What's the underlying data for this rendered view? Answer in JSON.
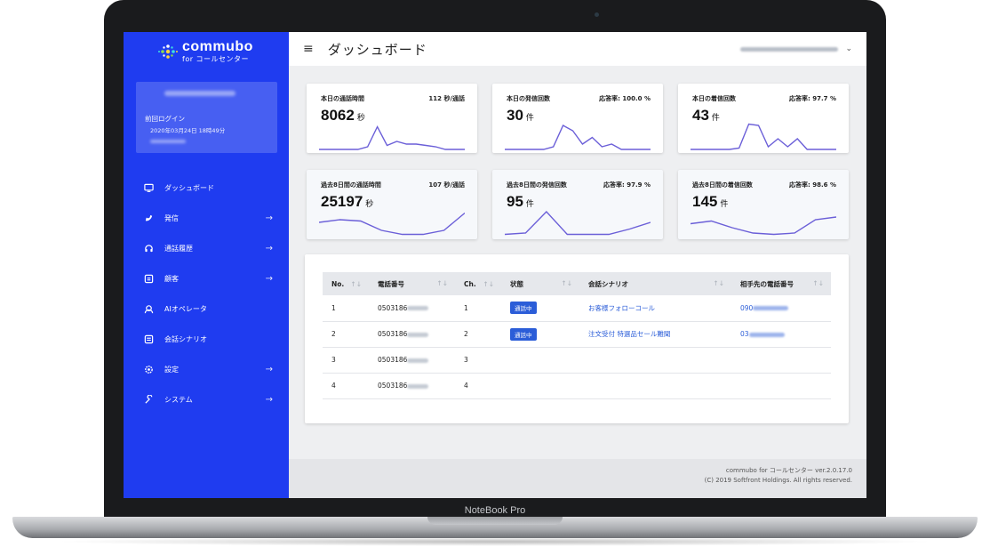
{
  "device": {
    "brand": "NoteBook Pro"
  },
  "app": {
    "name": "commubo",
    "subtitle": "for コールセンター"
  },
  "colors": {
    "sidebar": "#1f3cf0",
    "accent": "#2b5dd8",
    "chart_line": "#6b5fd8"
  },
  "user_card": {
    "last_login_label": "前回ログイン",
    "last_login_time": "2020年03月24日 18時49分"
  },
  "sidebar": {
    "items": [
      {
        "label": "ダッシュボード",
        "icon": "monitor-icon",
        "arrow": ""
      },
      {
        "label": "発信",
        "icon": "phone-outgoing-icon",
        "arrow": "→"
      },
      {
        "label": "通話履歴",
        "icon": "headset-icon",
        "arrow": "→"
      },
      {
        "label": "顧客",
        "icon": "contact-card-icon",
        "arrow": "→"
      },
      {
        "label": "AIオペレータ",
        "icon": "operator-icon",
        "arrow": ""
      },
      {
        "label": "会話シナリオ",
        "icon": "scenario-icon",
        "arrow": ""
      },
      {
        "label": "設定",
        "icon": "gear-icon",
        "arrow": "→"
      },
      {
        "label": "システム",
        "icon": "wrench-icon",
        "arrow": "→"
      }
    ]
  },
  "header": {
    "title": "ダッシュボード",
    "menu_icon": "hamburger-icon",
    "dropdown_icon": "chevron-down-icon"
  },
  "stats": [
    {
      "title": "本日の通話時間",
      "sub": "112 秒/通話",
      "value": "8062",
      "unit": "秒",
      "series": [
        0,
        0,
        0,
        0,
        0,
        0.1,
        0.85,
        0.15,
        0.3,
        0.2,
        0.2,
        0.15,
        0.1,
        0,
        0,
        0
      ]
    },
    {
      "title": "本日の発信回数",
      "sub": "応答率: 100.0 %",
      "value": "30",
      "unit": "件",
      "series": [
        0,
        0,
        0,
        0,
        0,
        0.1,
        0.9,
        0.7,
        0.2,
        0.45,
        0.1,
        0.2,
        0,
        0,
        0,
        0
      ]
    },
    {
      "title": "本日の着信回数",
      "sub": "応答率: 97.7 %",
      "value": "43",
      "unit": "件",
      "series": [
        0,
        0,
        0,
        0,
        0,
        0.05,
        0.95,
        0.9,
        0.1,
        0.4,
        0.1,
        0.4,
        0,
        0,
        0,
        0
      ]
    },
    {
      "title": "過去8日間の通話時間",
      "sub": "107 秒/通話",
      "value": "25197",
      "unit": "秒",
      "series": [
        0.5,
        0.6,
        0.55,
        0.2,
        0.05,
        0.05,
        0.2,
        0.85
      ]
    },
    {
      "title": "過去8日間の発信回数",
      "sub": "応答率: 97.9 %",
      "value": "95",
      "unit": "件",
      "series": [
        0.05,
        0.1,
        0.9,
        0.05,
        0.05,
        0.05,
        0.25,
        0.5
      ]
    },
    {
      "title": "過去8日間の着信回数",
      "sub": "応答率: 98.6 %",
      "value": "145",
      "unit": "件",
      "series": [
        0.45,
        0.55,
        0.3,
        0.1,
        0.05,
        0.1,
        0.6,
        0.7
      ]
    }
  ],
  "table": {
    "headers": [
      "No.",
      "電話番号",
      "Ch.",
      "状態",
      "会話シナリオ",
      "相手先の電話番号"
    ],
    "sort_icon": "↑↓",
    "rows": [
      {
        "no": "1",
        "phone": "0503186",
        "ch": "1",
        "status": "通話中",
        "scenario": "お客様フォローコール",
        "remote": "090"
      },
      {
        "no": "2",
        "phone": "0503186",
        "ch": "2",
        "status": "通話中",
        "scenario": "注文受付 特選品セール難聞",
        "remote": "03"
      },
      {
        "no": "3",
        "phone": "0503186",
        "ch": "3",
        "status": "",
        "scenario": "",
        "remote": ""
      },
      {
        "no": "4",
        "phone": "0503186",
        "ch": "4",
        "status": "",
        "scenario": "",
        "remote": ""
      }
    ]
  },
  "footer": {
    "version": "commubo for コールセンター ver.2.0.17.0",
    "copyright": "(C) 2019 Softfront Holdings. All rights reserved."
  }
}
